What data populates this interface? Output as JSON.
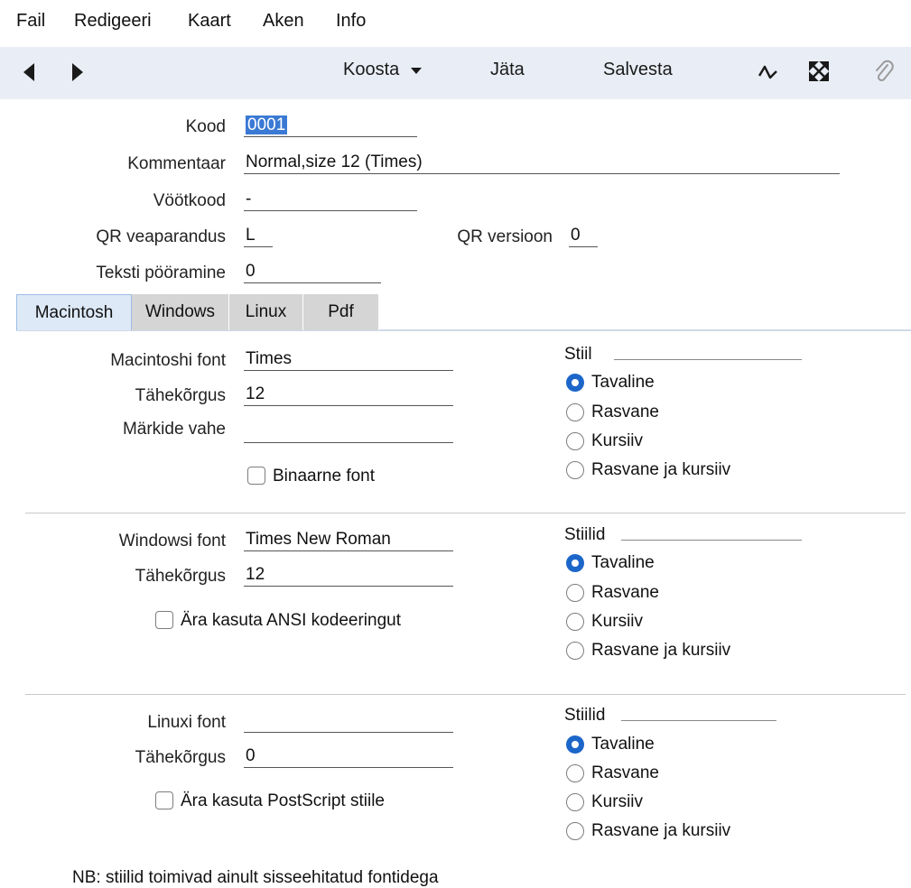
{
  "menu": [
    "Fail",
    "Redigeeri",
    "Kaart",
    "Aken",
    "Info"
  ],
  "toolbar": {
    "koosta": "Koosta",
    "jata": "Jäta",
    "salvesta": "Salvesta"
  },
  "header": {
    "kood_label": "Kood",
    "kood_value": "0001",
    "kommentaar_label": "Kommentaar",
    "kommentaar_value": "Normal,size 12 (Times)",
    "vootkood_label": "Vöötkood",
    "vootkood_value": "-",
    "qr_vea_label": "QR veaparandus",
    "qr_vea_value": "L",
    "qr_ver_label": "QR versioon",
    "qr_ver_value": "0",
    "poor_label": "Teksti pööramine",
    "poor_value": "0"
  },
  "tabs": [
    "Macintosh",
    "Windows",
    "Linux",
    "Pdf"
  ],
  "active_tab": "Macintosh",
  "mac": {
    "font_label": "Macintoshi font",
    "font_value": "Times",
    "size_label": "Tähekõrgus",
    "size_value": "12",
    "spacing_label": "Märkide vahe",
    "spacing_value": "",
    "binary_label": "Binaarne font",
    "style_title": "Stiil",
    "styles": [
      "Tavaline",
      "Rasvane",
      "Kursiiv",
      "Rasvane ja kursiiv"
    ],
    "selected": 0
  },
  "win": {
    "font_label": "Windowsi font",
    "font_value": "Times New Roman",
    "size_label": "Tähekõrgus",
    "size_value": "12",
    "ansi_label": "Ära kasuta ANSI kodeeringut",
    "style_title": "Stiilid",
    "styles": [
      "Tavaline",
      "Rasvane",
      "Kursiiv",
      "Rasvane ja kursiiv"
    ],
    "selected": 0
  },
  "linux": {
    "font_label": "Linuxi font",
    "font_value": "",
    "size_label": "Tähekõrgus",
    "size_value": "0",
    "ps_label": "Ära kasuta PostScript stiile",
    "style_title": "Stiilid",
    "styles": [
      "Tavaline",
      "Rasvane",
      "Kursiiv",
      "Rasvane ja kursiiv"
    ],
    "selected": 0
  },
  "note": "NB: stiilid toimivad ainult sisseehitatud fontidega",
  "colors": {
    "accent": "#1d66c9",
    "toolbar_bg": "#e9eef6",
    "selection": "#3a79d4"
  }
}
